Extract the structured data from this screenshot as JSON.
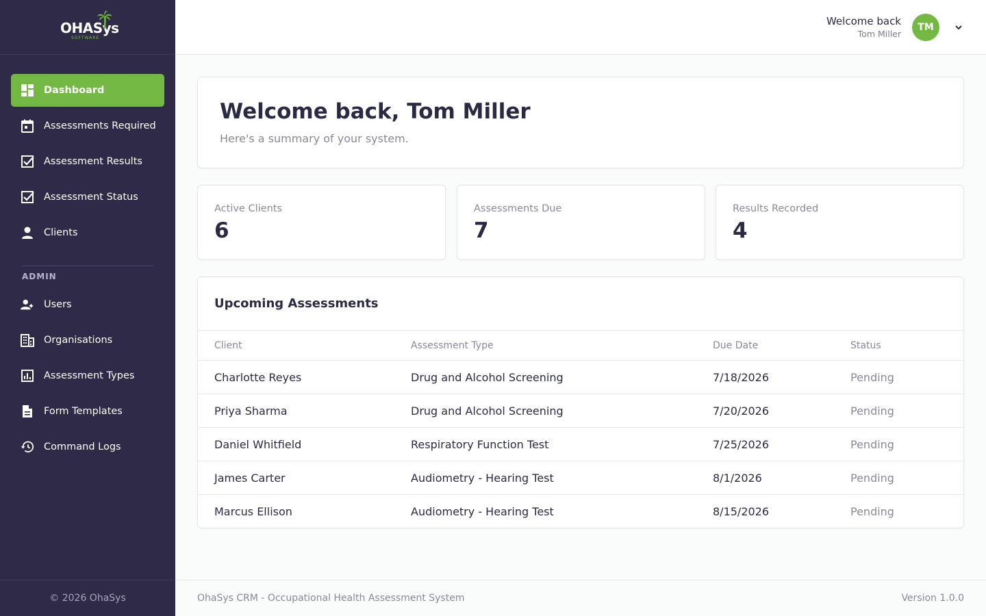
{
  "brand": {
    "name": "OHASys",
    "tagline": "SOFTWARE",
    "accent": "#72b843",
    "sidebar_bg": "#2f2a47"
  },
  "sidebar": {
    "items": [
      {
        "label": "Dashboard",
        "icon": "dashboard-icon",
        "active": true
      },
      {
        "label": "Assessments Required",
        "icon": "calendar-icon"
      },
      {
        "label": "Assessment Results",
        "icon": "checkbox-icon"
      },
      {
        "label": "Assessment Status",
        "icon": "checkbox-icon"
      },
      {
        "label": "Clients",
        "icon": "person-icon"
      }
    ],
    "admin_section": "ADMIN",
    "admin_items": [
      {
        "label": "Users",
        "icon": "users-icon"
      },
      {
        "label": "Organisations",
        "icon": "building-icon"
      },
      {
        "label": "Assessment Types",
        "icon": "bar-chart-icon"
      },
      {
        "label": "Form Templates",
        "icon": "document-icon"
      },
      {
        "label": "Command Logs",
        "icon": "history-icon"
      }
    ],
    "footer": "© 2026 OhaSys"
  },
  "header": {
    "welcome": "Welcome back",
    "user_name": "Tom Miller",
    "initials": "TM"
  },
  "main": {
    "welcome_title": "Welcome back, Tom Miller",
    "welcome_subtitle": "Here's a summary of your system.",
    "stats": [
      {
        "label": "Active Clients",
        "value": "6"
      },
      {
        "label": "Assessments Due",
        "value": "7"
      },
      {
        "label": "Results Recorded",
        "value": "4"
      }
    ],
    "upcoming": {
      "title": "Upcoming Assessments",
      "columns": [
        "Client",
        "Assessment Type",
        "Due Date",
        "Status"
      ],
      "rows": [
        [
          "Charlotte Reyes",
          "Drug and Alcohol Screening",
          "7/18/2026",
          "Pending"
        ],
        [
          "Priya Sharma",
          "Drug and Alcohol Screening",
          "7/20/2026",
          "Pending"
        ],
        [
          "Daniel Whitfield",
          "Respiratory Function Test",
          "7/25/2026",
          "Pending"
        ],
        [
          "James Carter",
          "Audiometry - Hearing Test",
          "8/1/2026",
          "Pending"
        ],
        [
          "Marcus Ellison",
          "Audiometry - Hearing Test",
          "8/15/2026",
          "Pending"
        ]
      ]
    }
  },
  "footer": {
    "left": "OhaSys CRM - Occupational Health Assessment System",
    "right": "Version 1.0.0"
  }
}
